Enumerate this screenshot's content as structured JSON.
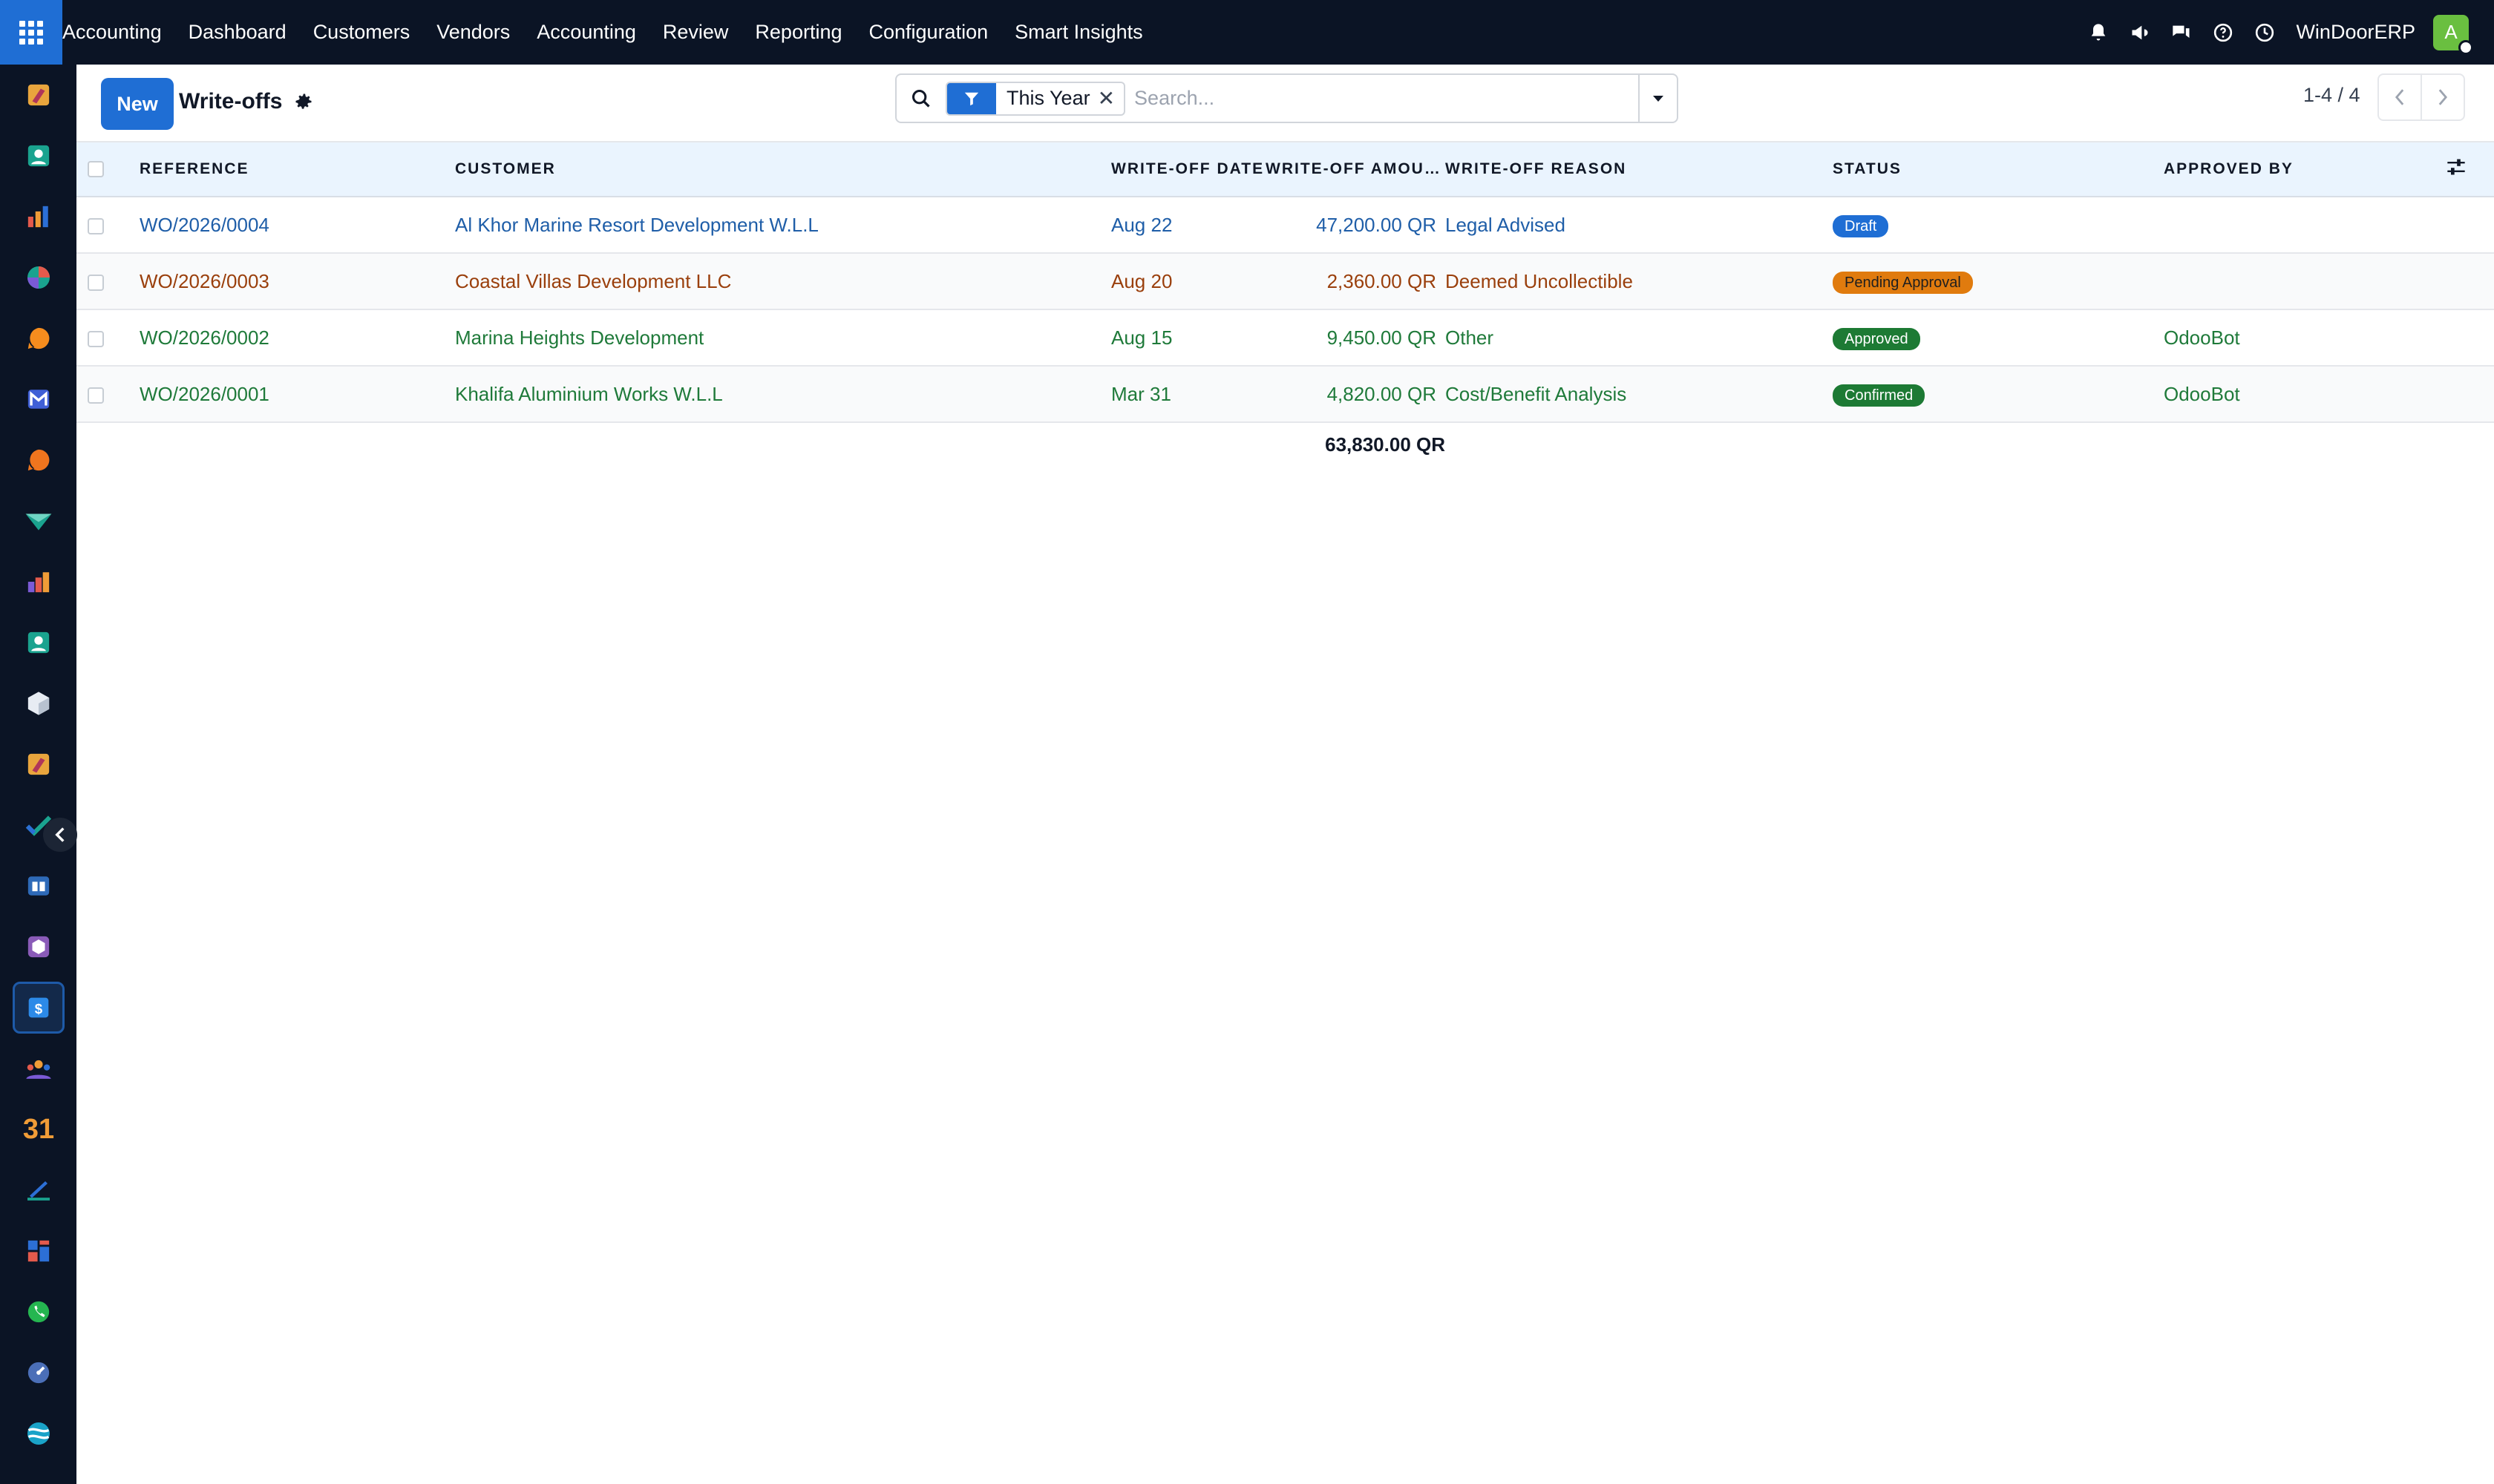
{
  "topbar": {
    "brand": "Accounting",
    "menu": [
      "Dashboard",
      "Customers",
      "Vendors",
      "Accounting",
      "Review",
      "Reporting",
      "Configuration",
      "Smart Insights"
    ],
    "company": "WinDoorERP",
    "avatar_initial": "A",
    "icons": [
      "bell-icon",
      "megaphone-icon",
      "chat-icon",
      "help-icon",
      "clock-icon"
    ]
  },
  "sidebar": {
    "apps": [
      "discuss-app-icon",
      "contacts-app-icon",
      "dashboard-app-icon",
      "crm-app-icon",
      "livechat-app-icon",
      "email-marketing-app-icon",
      "helpdesk-app-icon",
      "sales-app-icon",
      "reporting-app-icon",
      "employees-app-icon",
      "inventory-app-icon",
      "discuss-app-icon-2",
      "project-app-icon",
      "knowledge-app-icon",
      "products-app-icon",
      "accounting-app-icon",
      "team-app-icon",
      "calendar-app-icon",
      "sign-app-icon",
      "apps-dashboard-icon",
      "whatsapp-app-icon",
      "timesheet-app-icon",
      "website-app-icon"
    ],
    "active_index": 15,
    "calendar_label": "31"
  },
  "control": {
    "new_label": "New",
    "title": "Write-offs",
    "facet_label": "This Year",
    "search_placeholder": "Search...",
    "pager_value": "1-4 / 4"
  },
  "table": {
    "columns": [
      "REFERENCE",
      "CUSTOMER",
      "WRITE-OFF DATE",
      "WRITE-OFF AMOUNT",
      "WRITE-OFF REASON",
      "STATUS",
      "APPROVED BY"
    ],
    "rows": [
      {
        "reference": "WO/2026/0004",
        "customer": "Al Khor Marine Resort Development W.L.L",
        "date": "Aug 22",
        "amount": "47,200.00 QR",
        "reason": "Legal Advised",
        "status": "Draft",
        "status_color": "#1f6ed4",
        "approved_by": ""
      },
      {
        "reference": "WO/2026/0003",
        "customer": "Coastal Villas Development LLC",
        "date": "Aug 20",
        "amount": "2,360.00 QR",
        "reason": "Deemed Uncollectible",
        "status": "Pending Approval",
        "status_color": "#e07b0e",
        "approved_by": ""
      },
      {
        "reference": "WO/2026/0002",
        "customer": "Marina Heights Development",
        "date": "Aug 15",
        "amount": "9,450.00 QR",
        "reason": "Other",
        "status": "Approved",
        "status_color": "#1d7a34",
        "approved_by": "OdooBot"
      },
      {
        "reference": "WO/2026/0001",
        "customer": "Khalifa Aluminium Works W.L.L",
        "date": "Mar 31",
        "amount": "4,820.00 QR",
        "reason": "Cost/Benefit Analysis",
        "status": "Confirmed",
        "status_color": "#1d7a34",
        "approved_by": "OdooBot"
      }
    ],
    "total_amount": "63,830.00 QR"
  }
}
